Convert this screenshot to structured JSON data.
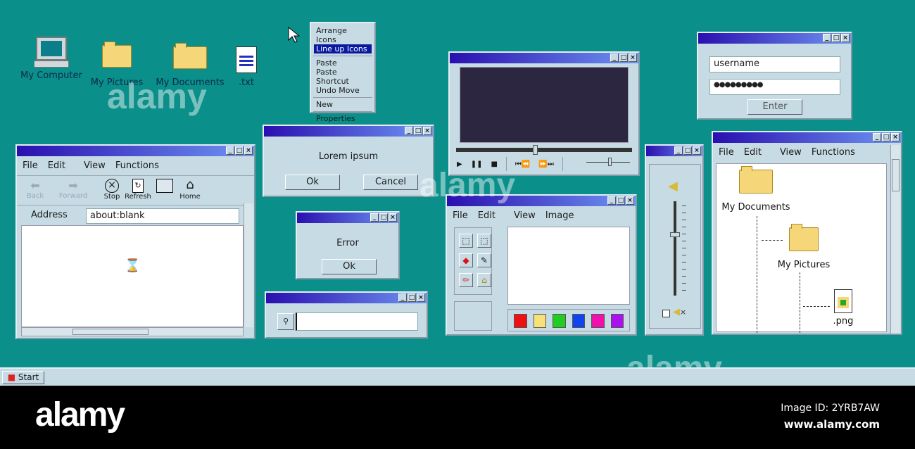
{
  "desktop": {
    "icons": [
      {
        "label": "My Computer"
      },
      {
        "label": "My Pictures"
      },
      {
        "label": "My Documents"
      },
      {
        "label": ".txt"
      }
    ]
  },
  "context_menu": {
    "items": [
      "Arrange Icons",
      "Line up Icons",
      "Paste",
      "Paste Shortcut",
      "Undo Move",
      "New",
      "Properties"
    ]
  },
  "browser": {
    "menu": [
      "File",
      "Edit",
      "View",
      "Functions"
    ],
    "toolbar": [
      "Back",
      "Forward",
      "Stop",
      "Refresh",
      "",
      "Home"
    ],
    "address_label": "Address",
    "address_value": "about:blank"
  },
  "dialog": {
    "message": "Lorem ipsum",
    "ok": "Ok",
    "cancel": "Cancel"
  },
  "error": {
    "message": "Error",
    "ok": "Ok"
  },
  "search": {
    "value": ""
  },
  "media": {
    "progress": 0.45,
    "volume": 0.55
  },
  "paint": {
    "menu": [
      "File",
      "Edit",
      "View",
      "Image"
    ],
    "colors": [
      "#ee1111",
      "#f7e27a",
      "#22cc22",
      "#1144ee",
      "#ee11aa",
      "#aa11ee"
    ]
  },
  "volume": {
    "level": 0.65,
    "mute_symbol": "×"
  },
  "login": {
    "username": "username",
    "password": "●●●●●●●●●",
    "enter": "Enter"
  },
  "explorer": {
    "menu": [
      "File",
      "Edit",
      "View",
      "Functions"
    ],
    "items": [
      "My Documents",
      "My Pictures",
      ".png"
    ]
  },
  "taskbar": {
    "start": "Start"
  },
  "footer": {
    "logo": "alamy",
    "image_id": "Image ID: 2YRB7AW",
    "url": "www.alamy.com"
  }
}
